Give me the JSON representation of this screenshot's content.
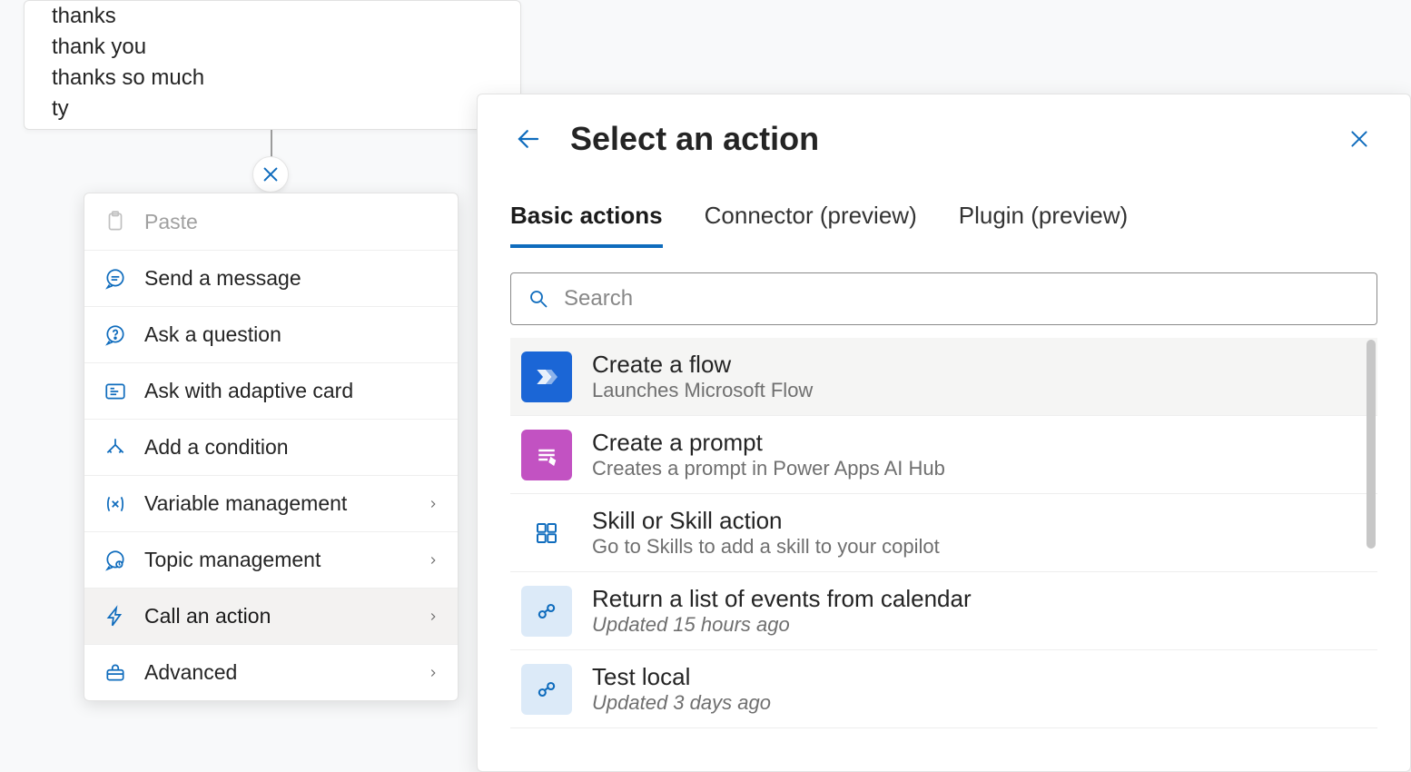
{
  "phrases": [
    "thanks",
    "thank you",
    "thanks so much",
    "ty"
  ],
  "context_menu": {
    "items": [
      {
        "label": "Paste",
        "has_submenu": false,
        "disabled": true,
        "icon": "paste-icon"
      },
      {
        "label": "Send a message",
        "has_submenu": false,
        "disabled": false,
        "icon": "chat-icon"
      },
      {
        "label": "Ask a question",
        "has_submenu": false,
        "disabled": false,
        "icon": "question-icon"
      },
      {
        "label": "Ask with adaptive card",
        "has_submenu": false,
        "disabled": false,
        "icon": "card-icon"
      },
      {
        "label": "Add a condition",
        "has_submenu": false,
        "disabled": false,
        "icon": "branch-icon"
      },
      {
        "label": "Variable management",
        "has_submenu": true,
        "disabled": false,
        "icon": "variable-icon"
      },
      {
        "label": "Topic management",
        "has_submenu": true,
        "disabled": false,
        "icon": "topic-icon"
      },
      {
        "label": "Call an action",
        "has_submenu": true,
        "disabled": false,
        "icon": "bolt-icon",
        "selected": true
      },
      {
        "label": "Advanced",
        "has_submenu": true,
        "disabled": false,
        "icon": "toolbox-icon"
      }
    ]
  },
  "action_panel": {
    "title": "Select an action",
    "tabs": [
      {
        "label": "Basic actions",
        "active": true
      },
      {
        "label": "Connector (preview)",
        "active": false
      },
      {
        "label": "Plugin (preview)",
        "active": false
      }
    ],
    "search_placeholder": "Search",
    "rows": [
      {
        "title": "Create a flow",
        "subtitle": "Launches Microsoft Flow",
        "icon": "flow",
        "highlight": true,
        "italic": false
      },
      {
        "title": "Create a prompt",
        "subtitle": "Creates a prompt in Power Apps AI Hub",
        "icon": "prompt",
        "highlight": false,
        "italic": false
      },
      {
        "title": "Skill or Skill action",
        "subtitle": "Go to Skills to add a skill to your copilot",
        "icon": "skill",
        "highlight": false,
        "italic": false
      },
      {
        "title": "Return a list of events from calendar",
        "subtitle": "Updated 15 hours ago",
        "icon": "cloudflow",
        "highlight": false,
        "italic": true
      },
      {
        "title": "Test local",
        "subtitle": "Updated 3 days ago",
        "icon": "cloudflow",
        "highlight": false,
        "italic": true
      }
    ]
  }
}
